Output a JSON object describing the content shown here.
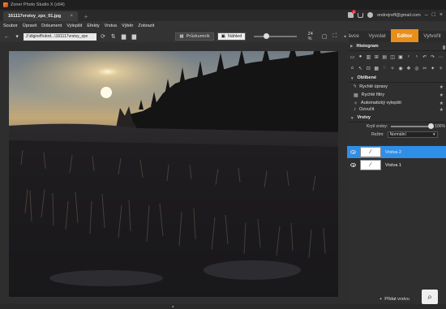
{
  "app": {
    "title": "Zoner Photo Studio X (x64)"
  },
  "doc_tab": {
    "filename": "161117vrstvy_zpx_01.jpg"
  },
  "header": {
    "email": "ondrejreff@gmail.com"
  },
  "menu": [
    "Soubor",
    "Úpravit",
    "Dokument",
    "Vylepšit",
    "Efekty",
    "Vrstva",
    "Výběr",
    "Zobrazit"
  ],
  "modes": [
    {
      "label": "Správce",
      "active": false
    },
    {
      "label": "Vyvolat",
      "active": false
    },
    {
      "label": "Editor",
      "active": true
    },
    {
      "label": "Vytvořit",
      "active": false
    }
  ],
  "toolbar": {
    "path": "J:\\digireff\\obrd...\\161117vrstvy_zpx",
    "browser_label": "Průzkumník",
    "preview_label": "Náhled",
    "zoom": "24 %",
    "zoom_fraction": 0.22
  },
  "panel": {
    "histogram_title": "Histogram",
    "favorites_title": "Oblíbené",
    "favorites": [
      {
        "label": "Rychlé úpravy",
        "icon": "lightning-icon"
      },
      {
        "label": "Rychlé filtry",
        "icon": "filter-icon"
      },
      {
        "label": "Automatický vylepšit",
        "icon": "magic-icon"
      },
      {
        "label": "Ozvučit",
        "icon": "sound-icon"
      }
    ],
    "layers_title": "Vrstvy",
    "opacity_label": "Krytí vrstvy:",
    "opacity_value": "100%",
    "blend_label": "Režim:",
    "blend_value": "Normální",
    "layers": [
      {
        "name": "Vrstva 2",
        "selected": true
      },
      {
        "name": "Vrstva 1",
        "selected": false
      }
    ],
    "add_layer_label": "Přidat vrstvu"
  },
  "colors": {
    "accent": "#e88e1a",
    "selection": "#2f8ee8"
  }
}
